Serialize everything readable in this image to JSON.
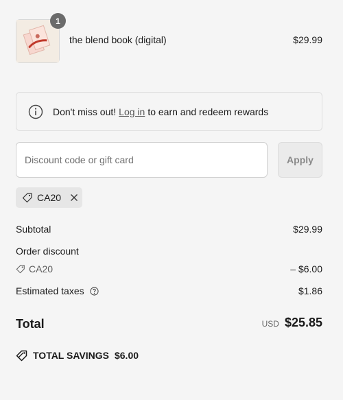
{
  "product": {
    "quantity_badge": "1",
    "name": "the blend book (digital)",
    "price": "$29.99"
  },
  "notice": {
    "text_before": "Don't miss out!",
    "link_text": "Log in",
    "text_after": "to earn and redeem rewards",
    "icon": "info-icon"
  },
  "discount": {
    "placeholder": "Discount code or gift card",
    "value": "",
    "apply_label": "Apply",
    "applied_code": "CA20"
  },
  "summary": {
    "subtotal_label": "Subtotal",
    "subtotal_value": "$29.99",
    "order_discount_label": "Order discount",
    "discount_code": "CA20",
    "discount_value": "– $6.00",
    "taxes_label": "Estimated taxes",
    "taxes_value": "$1.86",
    "total_label": "Total",
    "currency": "USD",
    "total_value": "$25.85",
    "savings_label": "TOTAL SAVINGS",
    "savings_value": "$6.00"
  },
  "colors": {
    "background": "#f5f5f5",
    "badge": "#6b6b6b",
    "chip": "#e6e6e6"
  }
}
